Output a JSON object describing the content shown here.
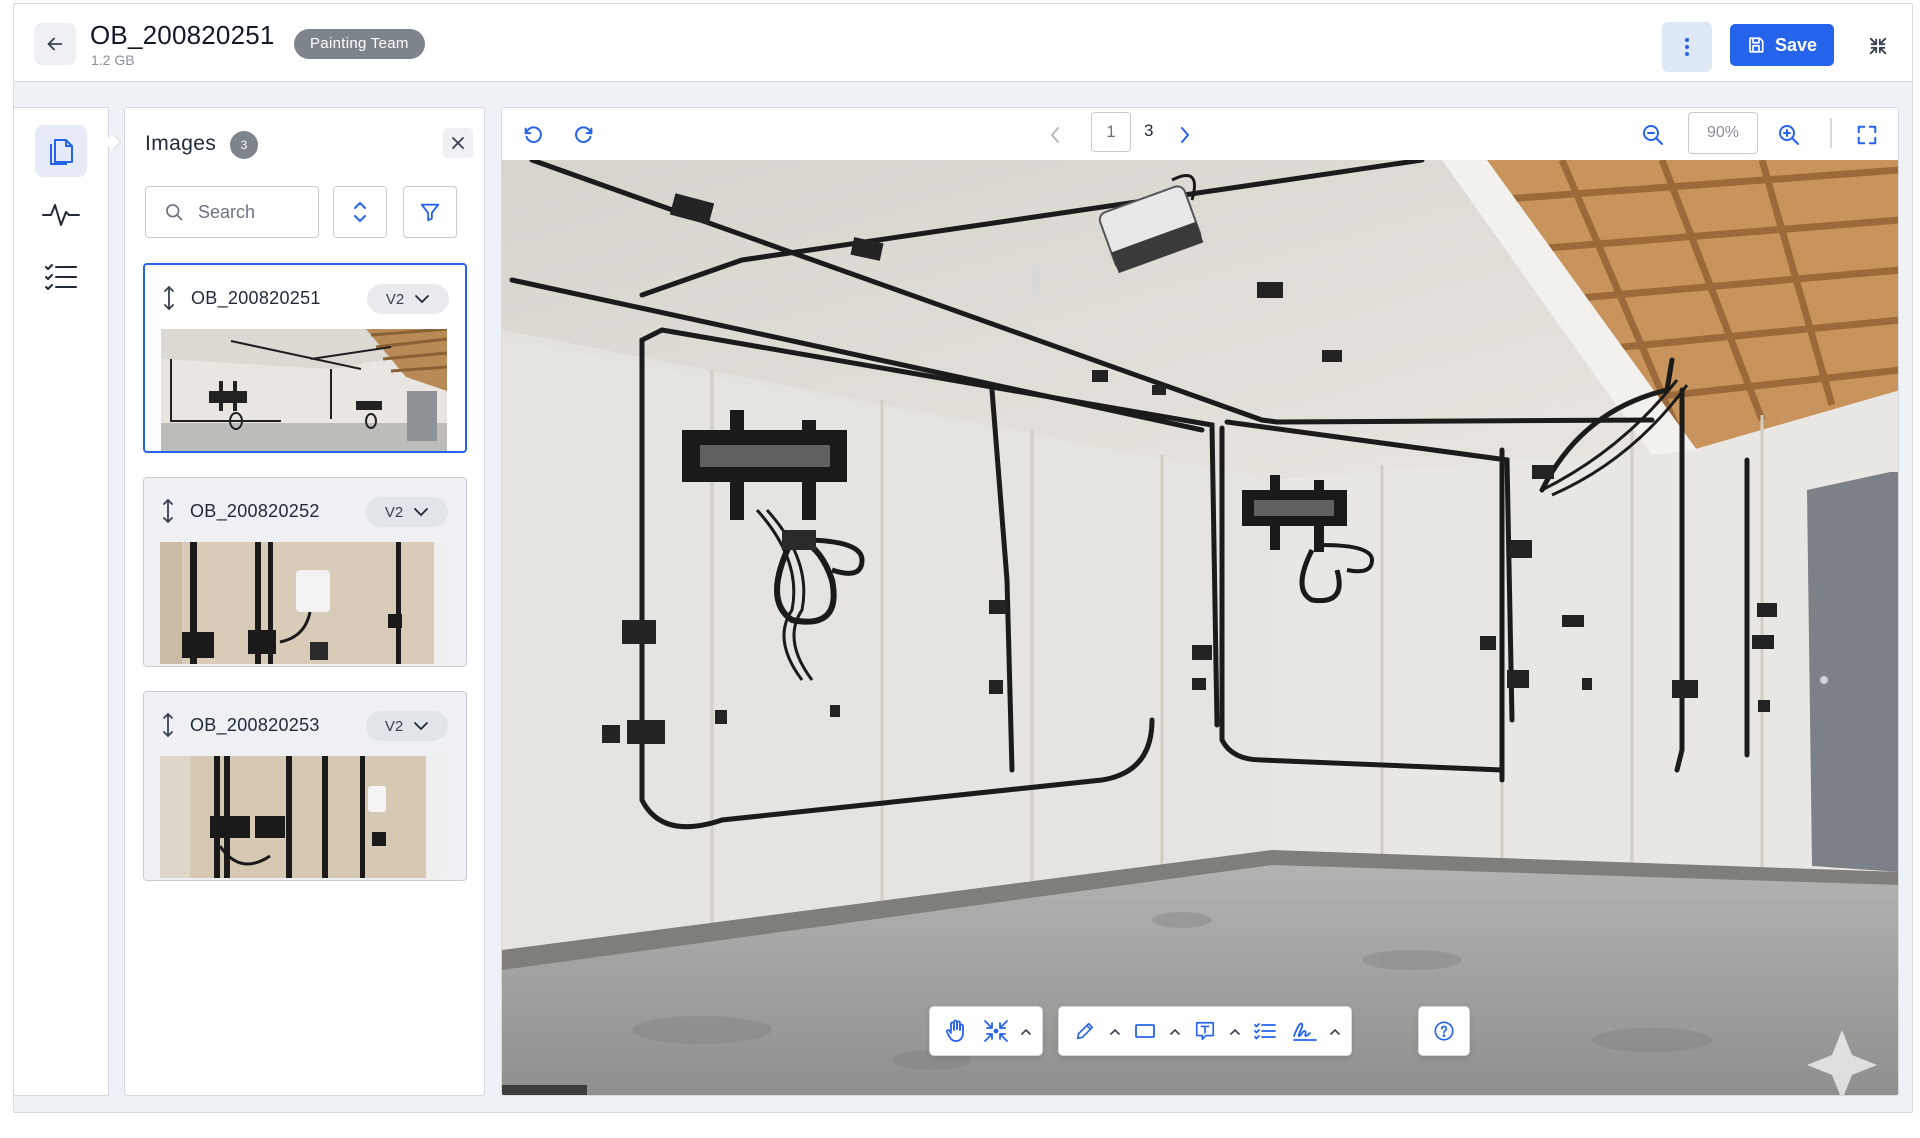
{
  "header": {
    "title": "OB_200820251",
    "size": "1.2 GB",
    "team_badge": "Painting Team",
    "save_label": "Save"
  },
  "sidebar": {
    "items": [
      {
        "icon": "documents-icon",
        "active": true
      },
      {
        "icon": "activity-icon",
        "active": false
      },
      {
        "icon": "checklist-icon",
        "active": false
      }
    ]
  },
  "images_panel": {
    "title": "Images",
    "count": "3",
    "search_placeholder": "Search",
    "cards": [
      {
        "name": "OB_200820251",
        "version": "V2",
        "selected": true
      },
      {
        "name": "OB_200820252",
        "version": "V2",
        "selected": false
      },
      {
        "name": "OB_200820253",
        "version": "V2",
        "selected": false
      }
    ]
  },
  "viewer": {
    "current_page": "1",
    "total_pages": "3",
    "zoom": "90%"
  },
  "colors": {
    "accent": "#2563eb",
    "badge": "#7d848c",
    "icon": "#2563eb"
  }
}
